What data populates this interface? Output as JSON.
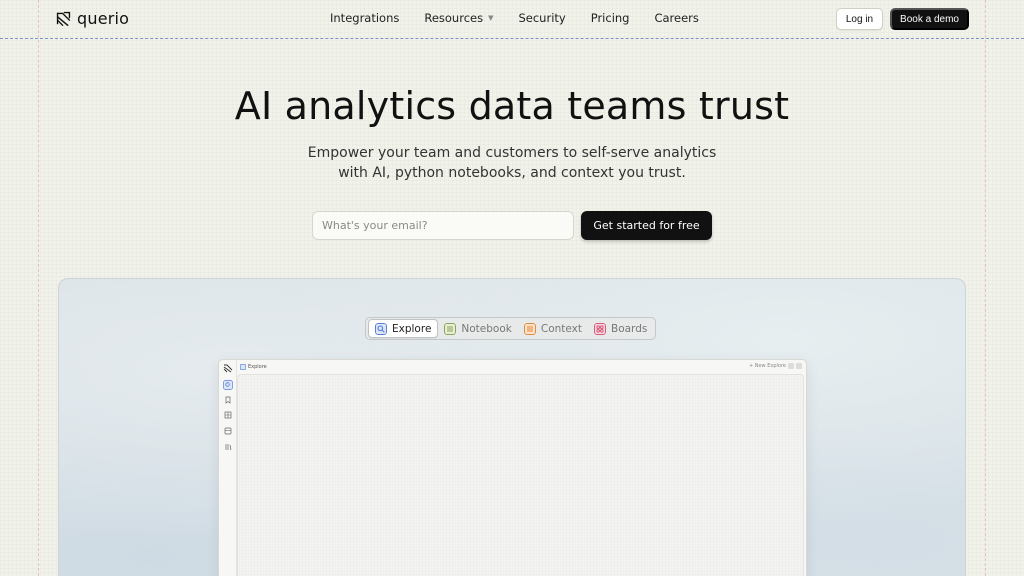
{
  "brand": {
    "name": "querio"
  },
  "nav": {
    "links": [
      {
        "label": "Integrations"
      },
      {
        "label": "Resources",
        "has_dropdown": true
      },
      {
        "label": "Security"
      },
      {
        "label": "Pricing"
      },
      {
        "label": "Careers"
      }
    ],
    "login_label": "Log in",
    "demo_label": "Book a demo"
  },
  "hero": {
    "title": "AI analytics data teams trust",
    "subtitle_line1": "Empower your team and customers to self-serve analytics",
    "subtitle_line2": "with AI, python notebooks, and context you trust.",
    "email_placeholder": "What's your email?",
    "cta_label": "Get started for free"
  },
  "showcase": {
    "tabs": [
      {
        "label": "Explore",
        "icon": "explore-icon",
        "color": "#5b7fd6",
        "active": true
      },
      {
        "label": "Notebook",
        "icon": "notebook-icon",
        "color": "#8aa35a",
        "active": false
      },
      {
        "label": "Context",
        "icon": "context-icon",
        "color": "#e08a3a",
        "active": false
      },
      {
        "label": "Boards",
        "icon": "boards-icon",
        "color": "#d65a7a",
        "active": false
      }
    ],
    "app": {
      "title": "Explore",
      "new_label": "+ New Explore"
    }
  },
  "colors": {
    "page_bg": "#f1f2ea",
    "primary_button": "#111111",
    "guide_horizontal": "#7b93c7",
    "guide_vertical": "#e3c4bd"
  }
}
